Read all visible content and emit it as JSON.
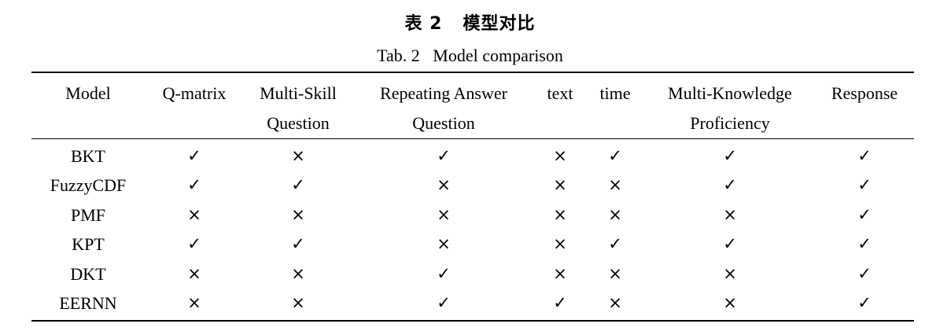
{
  "caption": {
    "cn": "表 2   模型对比",
    "en": "Tab. 2   Model comparison"
  },
  "table": {
    "headers": [
      [
        "Model"
      ],
      [
        "Q-matrix"
      ],
      [
        "Multi-Skill",
        "Question"
      ],
      [
        "Repeating Answer",
        "Question"
      ],
      [
        "text"
      ],
      [
        "time"
      ],
      [
        "Multi-Knowledge",
        "Proficiency"
      ],
      [
        "Response"
      ]
    ],
    "rows": [
      [
        "BKT",
        "✓",
        "×",
        "✓",
        "×",
        "✓",
        "✓",
        "✓"
      ],
      [
        "FuzzyCDF",
        "✓",
        "✓",
        "×",
        "×",
        "×",
        "✓",
        "✓"
      ],
      [
        "PMF",
        "×",
        "×",
        "×",
        "×",
        "×",
        "×",
        "✓"
      ],
      [
        "KPT",
        "✓",
        "✓",
        "×",
        "×",
        "✓",
        "✓",
        "✓"
      ],
      [
        "DKT",
        "×",
        "×",
        "✓",
        "×",
        "×",
        "×",
        "✓"
      ],
      [
        "EERNN",
        "×",
        "×",
        "✓",
        "✓",
        "×",
        "×",
        "✓"
      ]
    ]
  }
}
